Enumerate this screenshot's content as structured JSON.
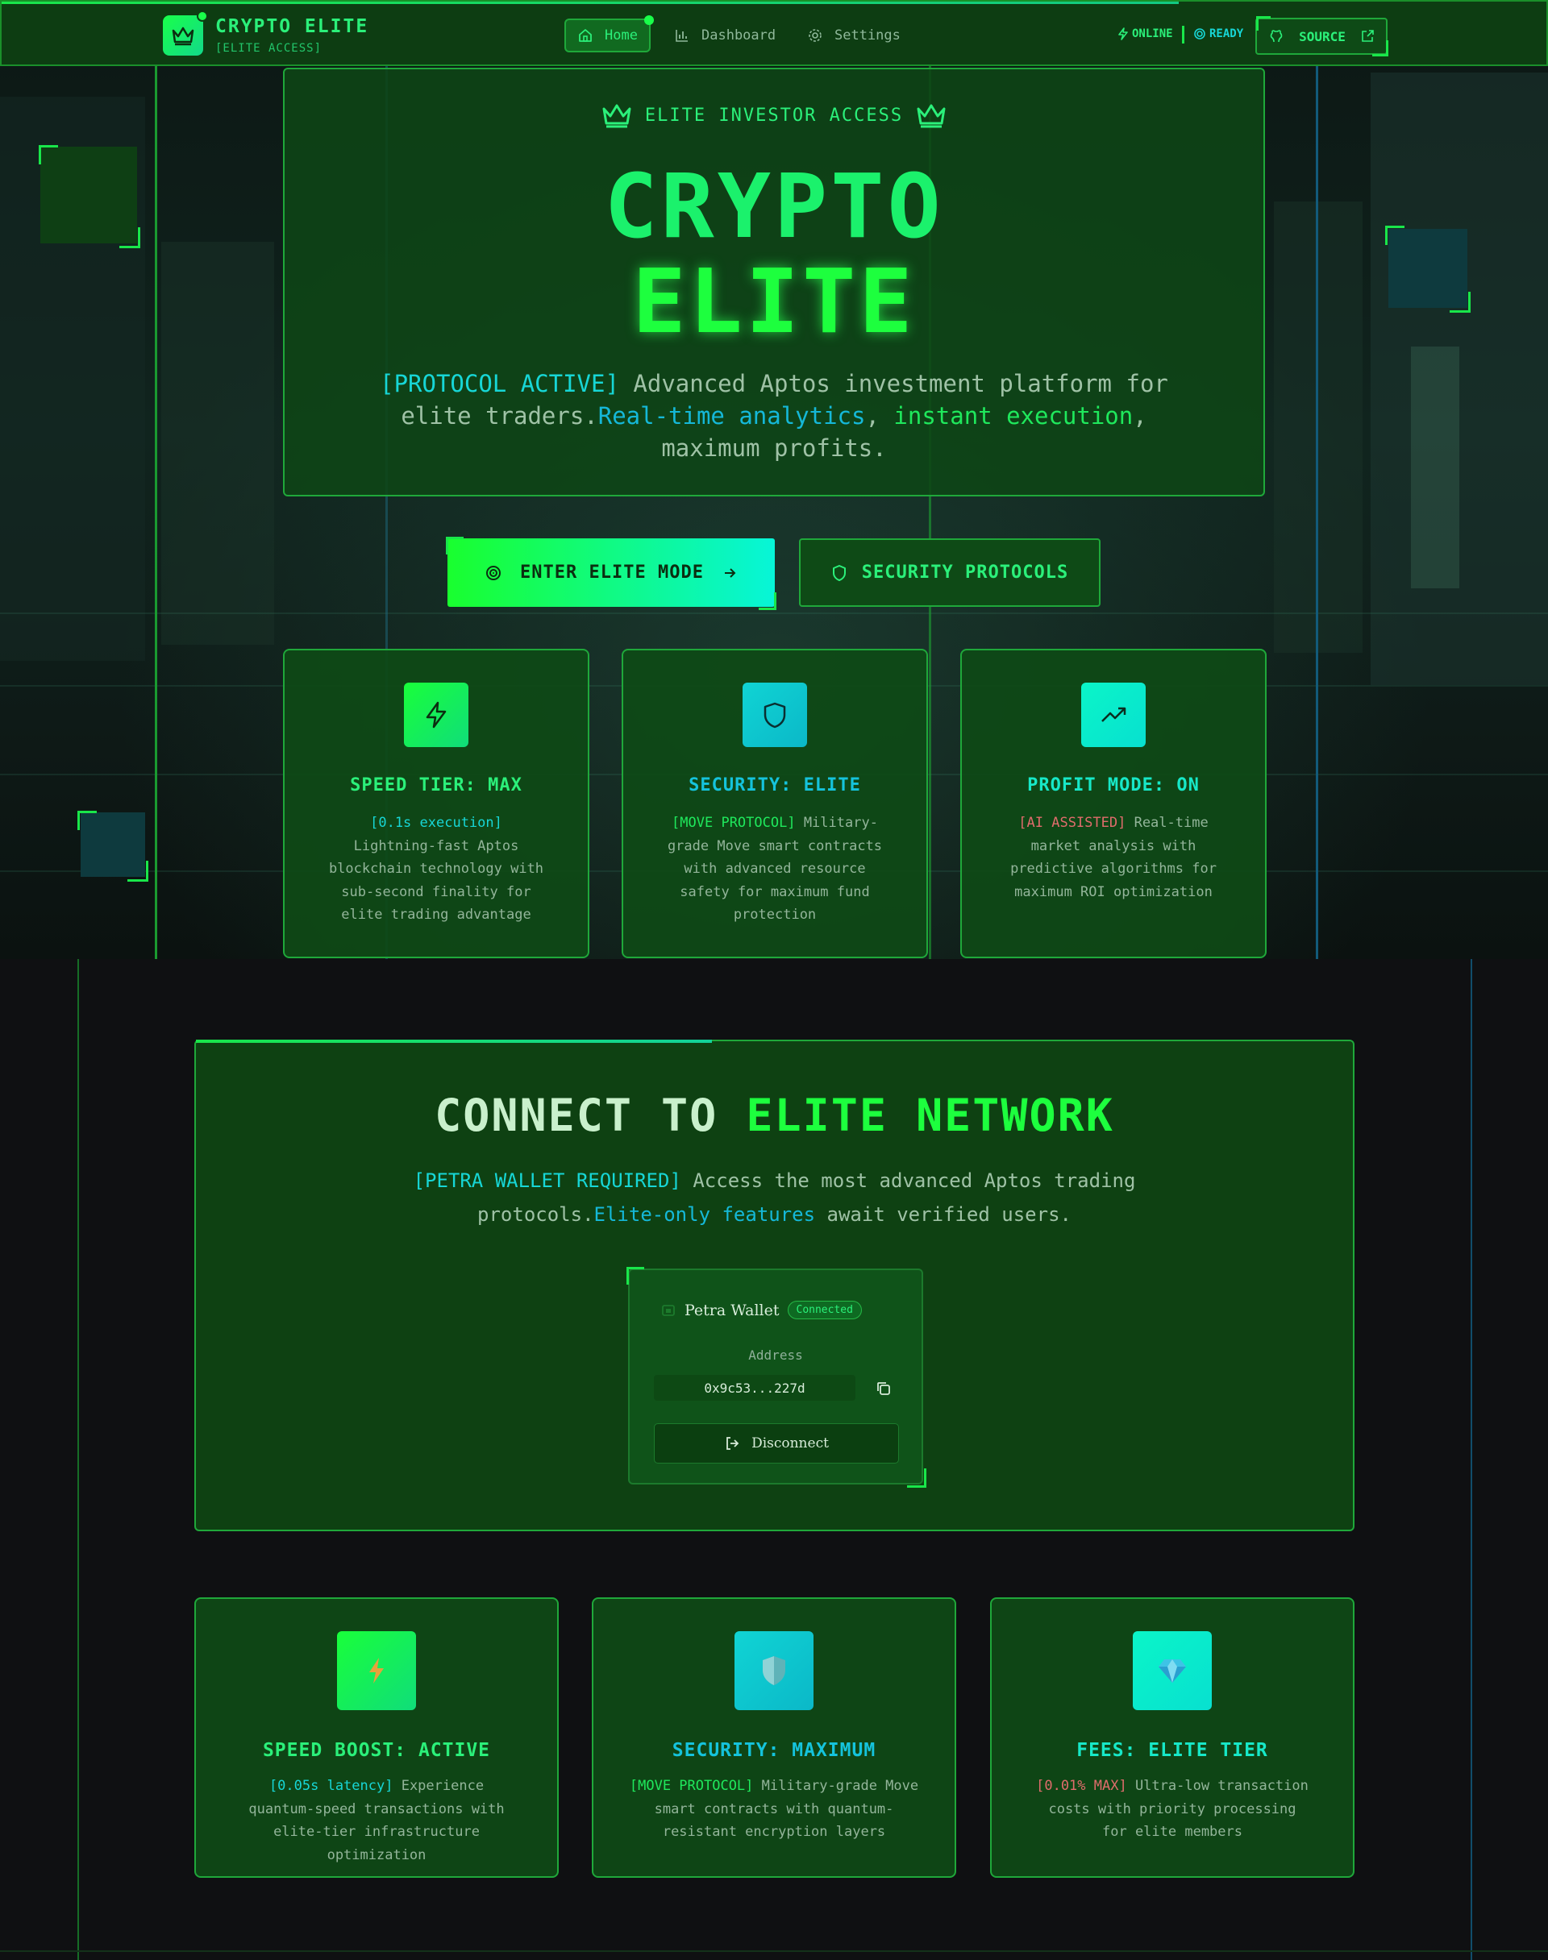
{
  "navbar": {
    "brand_title": "CRYPTO ELITE",
    "brand_subtitle": "[ELITE ACCESS]",
    "links": [
      {
        "label": "Home",
        "icon": "home-icon",
        "active": true
      },
      {
        "label": "Dashboard",
        "icon": "bar-chart-icon",
        "active": false
      },
      {
        "label": "Settings",
        "icon": "gear-icon",
        "active": false
      }
    ],
    "status_online": "ONLINE",
    "status_ready": "READY",
    "source_label": "SOURCE"
  },
  "hero": {
    "badge": "ELITE INVESTOR ACCESS",
    "title_line1": "CRYPTO",
    "title_line2": "ELITE",
    "desc_tag": "[PROTOCOL ACTIVE]",
    "desc_text1": " Advanced Aptos investment platform for elite traders.",
    "desc_highlight1": "Real-time analytics",
    "desc_sep": ", ",
    "desc_highlight2": "instant execution",
    "desc_text2": ", maximum profits."
  },
  "cta": {
    "primary_label": "ENTER ELITE MODE",
    "secondary_label": "SECURITY PROTOCOLS"
  },
  "features": [
    {
      "title": "SPEED TIER: MAX",
      "tag": "[0.1s execution]",
      "text": " Lightning-fast Aptos blockchain technology with sub-second finality for elite trading advantage",
      "icon": "lightning-icon"
    },
    {
      "title": "SECURITY: ELITE",
      "tag": "[MOVE PROTOCOL]",
      "text": " Military-grade Move smart contracts with advanced resource safety for maximum fund protection",
      "icon": "shield-icon"
    },
    {
      "title": "PROFIT MODE: ON",
      "tag": "[AI ASSISTED]",
      "text": " Real-time market analysis with predictive algorithms for maximum ROI optimization",
      "icon": "trending-up-icon"
    }
  ],
  "connect": {
    "title_part1": "CONNECT TO ",
    "title_part2": "ELITE NETWORK",
    "desc_tag": "[PETRA WALLET REQUIRED]",
    "desc_text1": " Access the most advanced Aptos trading protocols.",
    "desc_highlight": "Elite-only features",
    "desc_text2": " await verified users.",
    "wallet": {
      "name": "Petra Wallet",
      "status": "Connected",
      "address_label": "Address",
      "address": "0x9c53...227d",
      "disconnect_label": "Disconnect"
    }
  },
  "benefits": [
    {
      "title": "SPEED BOOST: ACTIVE",
      "tag": "[0.05s latency]",
      "text": " Experience quantum-speed transactions with elite-tier infrastructure optimization",
      "icon": "lightning-emoji-icon"
    },
    {
      "title": "SECURITY: MAXIMUM",
      "tag": "[MOVE PROTOCOL]",
      "text": " Military-grade Move smart contracts with quantum-resistant encryption layers",
      "icon": "shield-emoji-icon"
    },
    {
      "title": "FEES: ELITE TIER",
      "tag": "[0.01% MAX]",
      "text": " Ultra-low transaction costs with priority processing for elite members",
      "icon": "gem-icon"
    }
  ],
  "colors": {
    "accent_green": "#1dff3e",
    "accent_cyan": "#17d6d6",
    "panel_green": "#0e4a16",
    "border_green": "#1fa83a",
    "warn_red": "#e06c6c"
  }
}
